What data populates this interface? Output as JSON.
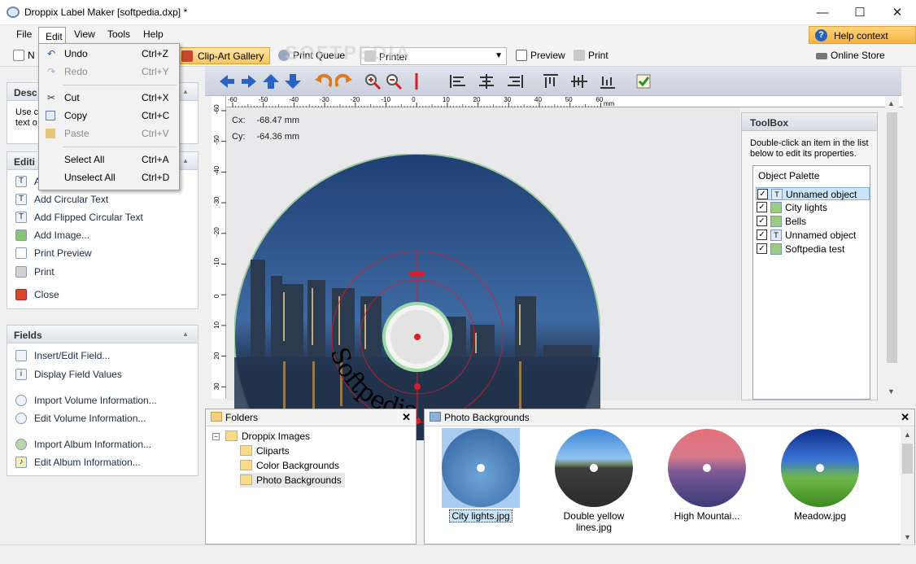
{
  "window": {
    "title": "Droppix Label Maker [softpedia.dxp] *",
    "minimize": "—",
    "maximize": "☐",
    "close": "✕"
  },
  "menu": {
    "file": "File",
    "edit": "Edit",
    "view": "View",
    "tools": "Tools",
    "help": "Help"
  },
  "help_context": {
    "label": "Help context",
    "icon": "?"
  },
  "toolbar": {
    "new": "N",
    "clipart": "Clip-Art Gallery",
    "print_queue": "Print Queue",
    "printer": "Printer",
    "preview": "Preview",
    "print": "Print",
    "online_store": "Online Store"
  },
  "edit_menu": {
    "items": [
      {
        "label": "Undo",
        "shortcut": "Ctrl+Z",
        "icon": "undo-icon"
      },
      {
        "label": "Redo",
        "shortcut": "Ctrl+Y",
        "icon": "redo-icon",
        "disabled": true
      },
      {
        "label": "Cut",
        "shortcut": "Ctrl+X",
        "icon": "scissors-icon"
      },
      {
        "label": "Copy",
        "shortcut": "Ctrl+C",
        "icon": "copy-icon"
      },
      {
        "label": "Paste",
        "shortcut": "Ctrl+V",
        "icon": "paste-icon",
        "disabled": true
      },
      {
        "label": "Select All",
        "shortcut": "Ctrl+A"
      },
      {
        "label": "Unselect All",
        "shortcut": "Ctrl+D"
      }
    ]
  },
  "left": {
    "description": {
      "title": "Desc",
      "text1": "Use c",
      "text2": "text o"
    },
    "editing": {
      "title": "Editi",
      "items": [
        "A",
        "Add Circular Text",
        "Add Flipped Circular Text",
        "Add Image...",
        "Print Preview",
        "Print",
        "Close"
      ]
    },
    "fields": {
      "title": "Fields",
      "items": [
        "Insert/Edit Field...",
        "Display Field Values",
        "Import Volume Information...",
        "Edit Volume Information...",
        "Import Album Information...",
        "Edit Album Information..."
      ]
    }
  },
  "ruler": {
    "unit": "mm",
    "h_ticks": [
      "-60",
      "-50",
      "-40",
      "-30",
      "-20",
      "-10",
      "0",
      "10",
      "20",
      "30",
      "40",
      "50",
      "60"
    ],
    "v_ticks": [
      "-60",
      "-50",
      "-40",
      "-30",
      "-20",
      "-10",
      "0",
      "10",
      "20",
      "30"
    ]
  },
  "coords": {
    "cx_label": "Cx:",
    "cx": "-68.47 mm",
    "cy_label": "Cy:",
    "cy": "-64.36 mm"
  },
  "disc": {
    "curved_text": "Softpedia"
  },
  "toolbox": {
    "title": "ToolBox",
    "desc": "Double-click an item in the list below to edit its properties.",
    "palette_title": "Object Palette",
    "objects": [
      {
        "name": "Unnamed object",
        "type": "text",
        "checked": true
      },
      {
        "name": "City lights",
        "type": "image",
        "checked": true
      },
      {
        "name": "Bells",
        "type": "image",
        "checked": true
      },
      {
        "name": "Unnamed object",
        "type": "text",
        "checked": true
      },
      {
        "name": "Softpedia test",
        "type": "image",
        "checked": true
      }
    ]
  },
  "folders": {
    "title": "Folders",
    "root": "Droppix Images",
    "children": [
      "Cliparts",
      "Color Backgrounds",
      "Photo Backgrounds"
    ]
  },
  "photos": {
    "title": "Photo Backgrounds",
    "items": [
      {
        "label": "City lights.jpg",
        "selected": true
      },
      {
        "label": "Double yellow lines.jpg"
      },
      {
        "label": "High Mountai..."
      },
      {
        "label": "Meadow.jpg"
      }
    ]
  },
  "watermark": "SOFTPEDIA",
  "colors": {
    "accent": "#f6b440",
    "selection": "#cce4f7",
    "crosshair": "#d81d2a"
  }
}
